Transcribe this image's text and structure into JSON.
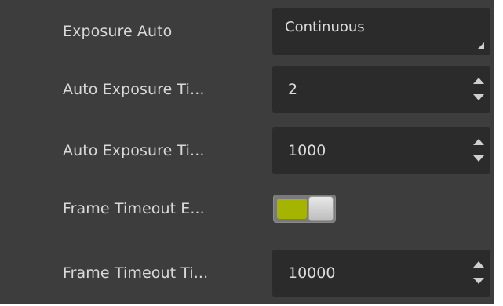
{
  "colors": {
    "panel_bg": "#3d3d3d",
    "field_bg": "#2b2b2b",
    "toggle_on": "#a4b400"
  },
  "rows": [
    {
      "label": "Exposure Auto",
      "type": "select",
      "value": "Continuous"
    },
    {
      "label": "Auto Exposure Ti...",
      "type": "spinbox",
      "value": "2",
      "icons": [
        "spin-up-icon",
        "spin-down-icon"
      ]
    },
    {
      "label": "Auto Exposure Ti...",
      "type": "spinbox",
      "value": "1000",
      "icons": [
        "spin-up-icon",
        "spin-down-icon"
      ]
    },
    {
      "label": "Frame Timeout E...",
      "type": "toggle",
      "on": true
    },
    {
      "label": "Frame Timeout Ti...",
      "type": "spinbox",
      "value": "10000",
      "icons": [
        "spin-up-icon",
        "spin-down-icon"
      ]
    }
  ]
}
